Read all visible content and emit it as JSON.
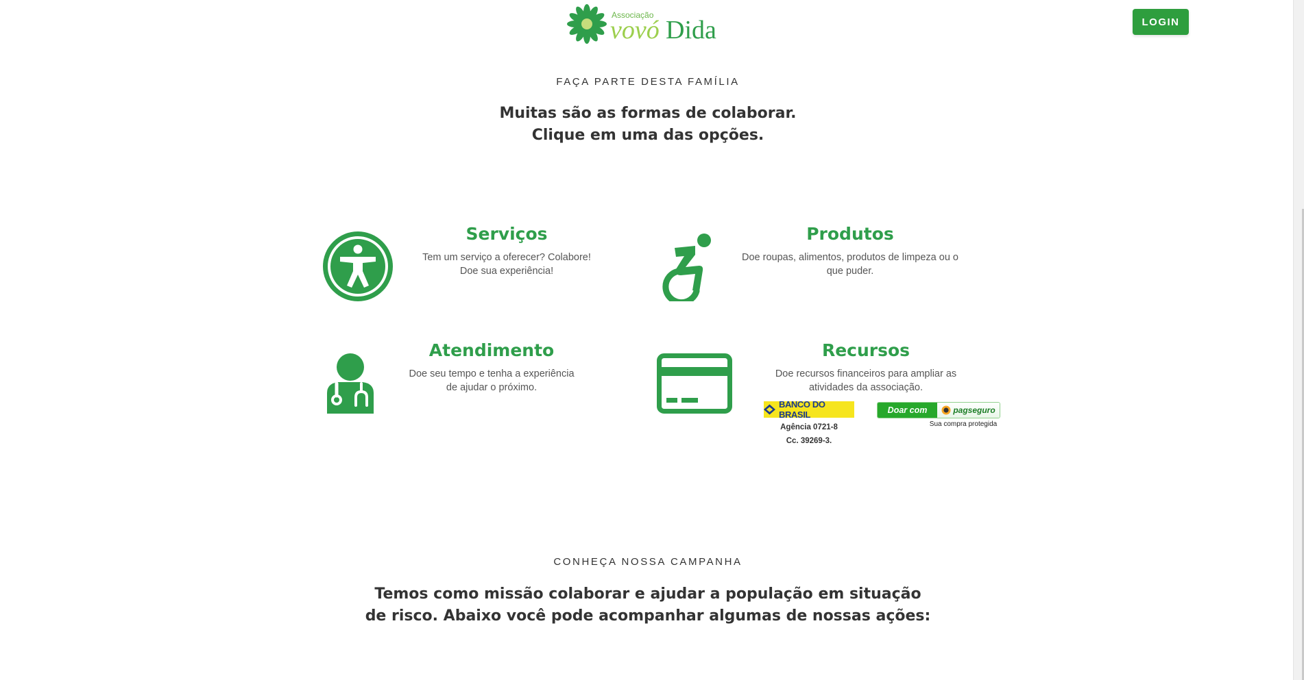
{
  "header": {
    "logo": {
      "prefix": "Associação",
      "name_part1": "vovó",
      "name_part2": "Dida"
    },
    "login_label": "LOGIN"
  },
  "collaborate": {
    "eyebrow": "FAÇA PARTE DESTA FAMÍLIA",
    "lead_line1": "Muitas são as formas de colaborar.",
    "lead_line2": "Clique em uma das opções.",
    "cards": [
      {
        "title": "Serviços",
        "description": "Tem um serviço a oferecer? Colabore! Doe sua experiência!",
        "icon": "accessibility-icon"
      },
      {
        "title": "Produtos",
        "description": "Doe roupas, alimentos, produtos de limpeza ou o que puder.",
        "icon": "wheelchair-icon"
      },
      {
        "title": "Atendimento",
        "description": "Doe seu tempo e tenha a experiência de ajudar o próximo.",
        "icon": "doctor-icon"
      },
      {
        "title": "Recursos",
        "description": "Doe recursos financeiros para ampliar as atividades da associação.",
        "icon": "credit-card-icon"
      }
    ],
    "bank": {
      "name": "BANCO DO BRASIL",
      "agency": "Agência 0721-8",
      "account": "Cc. 39269-3."
    },
    "pagseguro": {
      "button_label": "Doar com",
      "brand": "pagseguro",
      "caption": "Sua compra protegida"
    }
  },
  "campaign": {
    "eyebrow": "CONHEÇA NOSSA CAMPANHA",
    "lead_line1": "Temos como missão colaborar e ajudar a população em situação",
    "lead_line2": "de risco. Abaixo você pode acompanhar algumas de nossas ações:"
  },
  "colors": {
    "brand_green": "#2f9e4b",
    "button_green": "#2e9e3e",
    "bank_yellow": "#f6e51e",
    "bank_blue": "#1a3a8a"
  }
}
